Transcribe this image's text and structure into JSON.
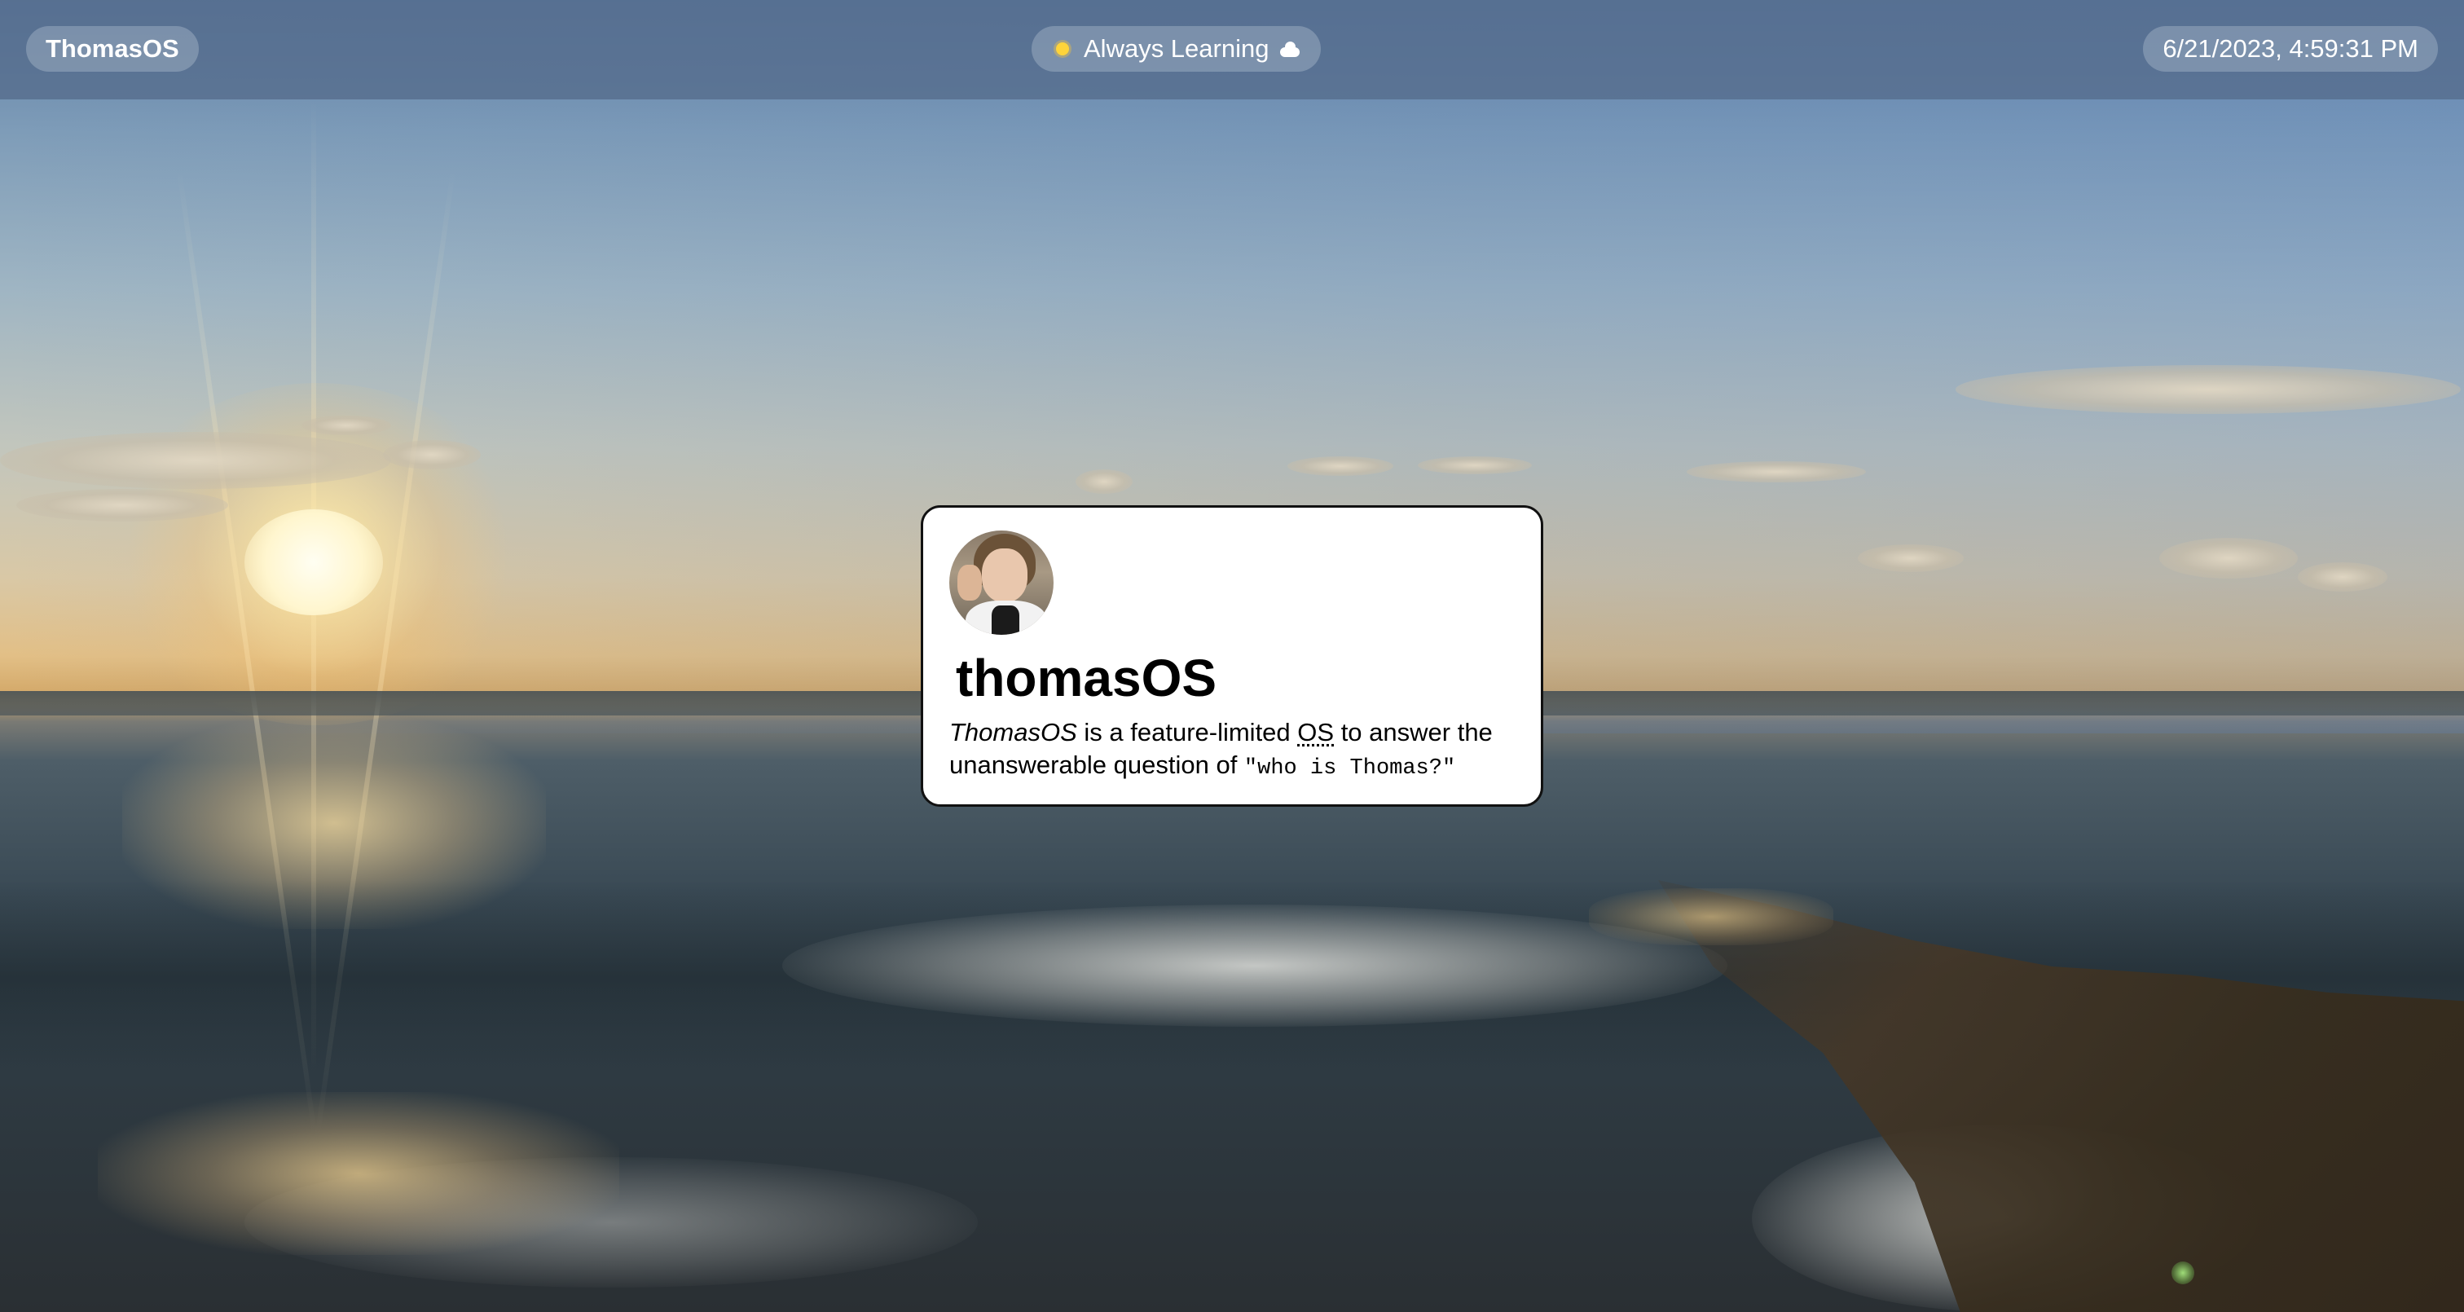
{
  "menubar": {
    "brand": "ThomasOS",
    "tagline": {
      "icon_left": "sun-icon",
      "text": "Always Learning",
      "icon_right": "cloud-icon"
    },
    "clock": "6/21/2023, 4:59:31 PM"
  },
  "window": {
    "avatar": "avatar-photo",
    "title": "thomasOS",
    "description": {
      "emphasis": "ThomasOS",
      "part1": " is a feature-limited ",
      "abbr": "OS",
      "part2": " to answer the unanswerable question of ",
      "code": "\"who is Thomas?\""
    }
  },
  "wallpaper": {
    "scene": "sunset-over-lake",
    "colors": {
      "sky_top": "#5f7fa6",
      "horizon_glow": "#e2bf86",
      "water": "#3a4a55",
      "menubar": "#556c8c"
    }
  }
}
